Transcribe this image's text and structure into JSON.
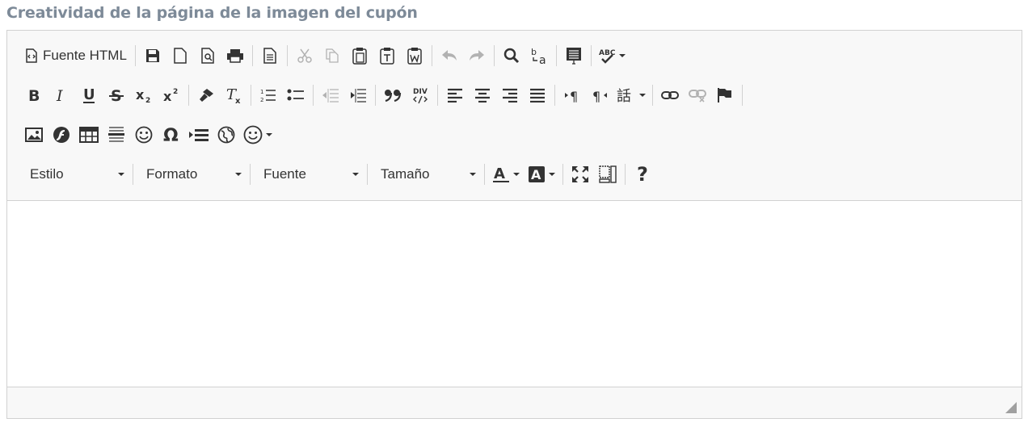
{
  "page": {
    "title": "Creatividad de la página de la imagen del cupón"
  },
  "toolbar": {
    "source_label": "Fuente HTML",
    "combos": {
      "style": "Estilo",
      "format": "Formato",
      "font": "Fuente",
      "size": "Tamaño"
    },
    "help_label": "?",
    "icons": {
      "row1": [
        "source-icon",
        "save-icon",
        "new-page-icon",
        "preview-icon",
        "print-icon",
        "templates-icon",
        "cut-icon",
        "copy-icon",
        "paste-icon",
        "paste-text-icon",
        "paste-word-icon",
        "undo-icon",
        "redo-icon",
        "find-icon",
        "replace-icon",
        "select-all-icon",
        "spellcheck-icon"
      ],
      "row2": [
        "bold-icon",
        "italic-icon",
        "underline-icon",
        "strike-icon",
        "subscript-icon",
        "superscript-icon",
        "copy-format-icon",
        "remove-format-icon",
        "numbered-list-icon",
        "bulleted-list-icon",
        "outdent-icon",
        "indent-icon",
        "blockquote-icon",
        "div-icon",
        "align-left-icon",
        "align-center-icon",
        "align-right-icon",
        "justify-icon",
        "ltr-icon",
        "rtl-icon",
        "language-icon",
        "link-icon",
        "unlink-icon",
        "anchor-icon"
      ],
      "row3": [
        "image-icon",
        "flash-icon",
        "table-icon",
        "horizontal-rule-icon",
        "smiley-icon",
        "special-char-icon",
        "page-break-icon",
        "iframe-icon",
        "emoji-icon"
      ],
      "row4": [
        "text-color-icon",
        "bg-color-icon",
        "maximize-icon",
        "show-blocks-icon",
        "help-icon"
      ]
    }
  },
  "colors": {
    "title": "#7d8a98",
    "toolbar_bg": "#f8f8f8",
    "border": "#d1d1d1",
    "icon": "#333333"
  }
}
